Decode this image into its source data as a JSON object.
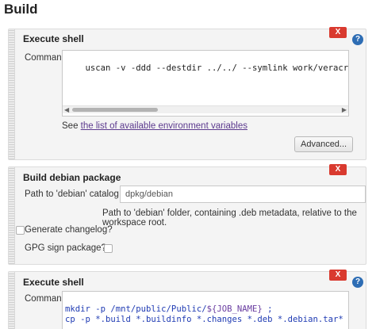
{
  "section": {
    "title": "Build"
  },
  "steps": [
    {
      "title": "Execute shell",
      "delete_label": "X",
      "help_label": "?",
      "command_label": "Command",
      "command_lines": [
        "uscan -v -ddd --destdir ../../ --symlink work/veracrypt ; mkdir -p"
      ],
      "env_note_prefix": "See ",
      "env_note_link": "the list of available environment variables",
      "advanced_label": "Advanced..."
    },
    {
      "title": "Build debian package",
      "delete_label": "X",
      "path_label": "Path to 'debian' catalog",
      "path_value": "dpkg/debian",
      "path_help": "Path to 'debian' folder, containing .deb metadata, relative to the workspace root.",
      "changelog_label": "Generate changelog?",
      "gpg_label": "GPG sign package?"
    },
    {
      "title": "Execute shell",
      "delete_label": "X",
      "help_label": "?",
      "command_label": "Command",
      "line1_a": "mkdir -p /mnt/public/Public/",
      "line1_var": "${JOB_NAME}",
      "line1_b": " ;",
      "line2": "cp -p *.build *.buildinfo *.changes *.deb *.debian.tar* *.dsc /mnt/"
    }
  ]
}
